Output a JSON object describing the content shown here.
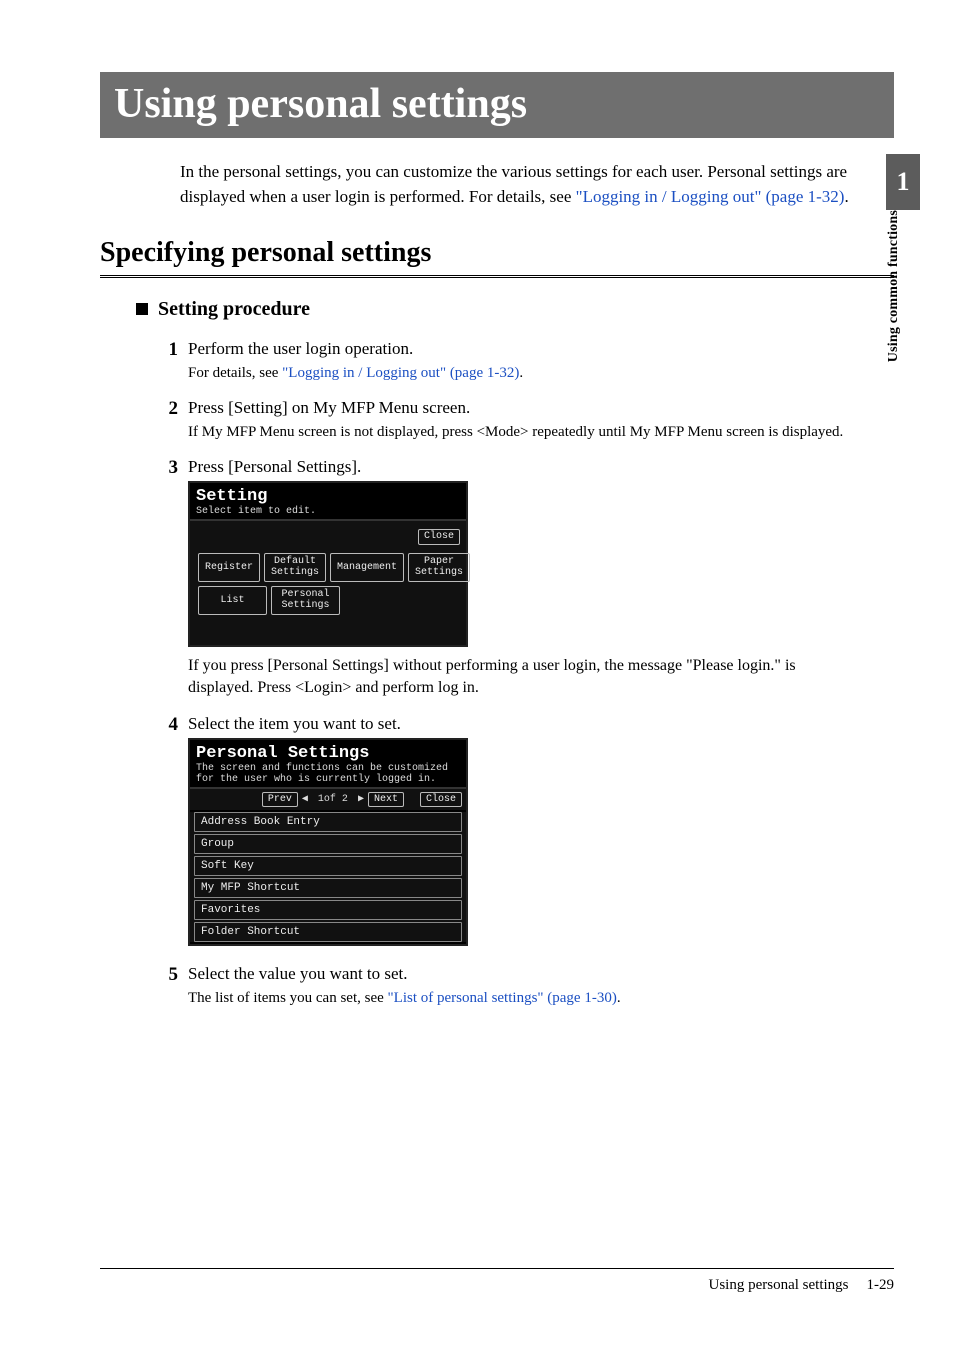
{
  "sideTab": {
    "chapter": "1",
    "label": "Using common functions"
  },
  "title": "Using personal settings",
  "intro": {
    "pre": "In the personal settings, you can customize the various settings for each user. Personal settings are displayed when a user login is performed. For details, see ",
    "link": "\"Logging in / Logging out\" (page 1-32)",
    "post": "."
  },
  "h2": "Specifying personal settings",
  "h3": "Setting procedure",
  "steps": {
    "s1": {
      "num": "1",
      "main": "Perform the user login operation.",
      "sub_pre": "For details, see ",
      "sub_link": "\"Logging in / Logging out\" (page 1-32)",
      "sub_post": "."
    },
    "s2": {
      "num": "2",
      "main": "Press [Setting] on My MFP Menu screen.",
      "sub": "If My MFP Menu screen is not displayed, press <Mode> repeatedly until My MFP Menu screen is displayed."
    },
    "s3": {
      "num": "3",
      "main": "Press [Personal Settings].",
      "after": "If you press [Personal Settings] without performing a user login, the message \"Please login.\" is displayed.  Press <Login> and perform log in."
    },
    "s4": {
      "num": "4",
      "main": "Select the item you want to set."
    },
    "s5": {
      "num": "5",
      "main": "Select the value you want to set.",
      "sub_pre": "The list of items you can set, see ",
      "sub_link": "\"List of personal settings\" (page 1-30)",
      "sub_post": "."
    }
  },
  "lcd1": {
    "title": "Setting",
    "sub": "Select item to edit.",
    "close": "Close",
    "row1": [
      "Register",
      "Default Settings",
      "Management",
      "Paper Settings"
    ],
    "row2": [
      "List",
      "Personal Settings"
    ]
  },
  "lcd2": {
    "title": "Personal Settings",
    "sub": "The screen and functions can be customized for the user who is currently logged in.",
    "prev": "Prev",
    "pos": "1of  2",
    "next": "Next",
    "close": "Close",
    "items": [
      "Address Book Entry",
      "Group",
      "Soft Key",
      "My MFP Shortcut",
      "Favorites",
      "Folder Shortcut"
    ]
  },
  "footer": {
    "title": "Using personal settings",
    "page": "1-29"
  }
}
